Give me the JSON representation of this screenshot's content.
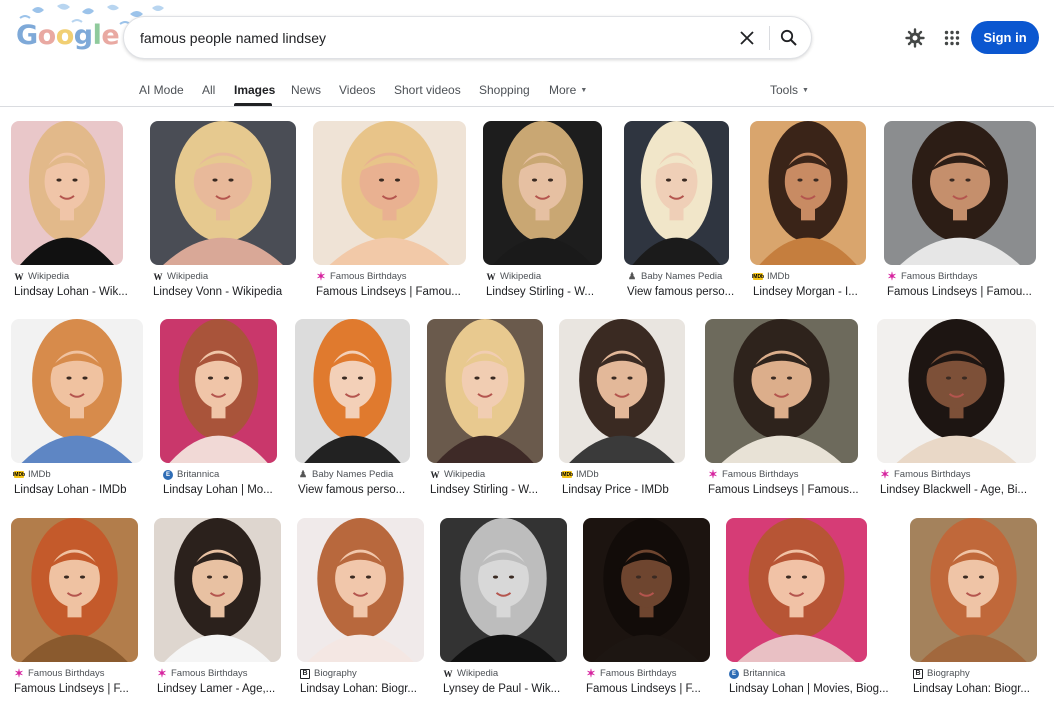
{
  "header": {
    "logo_letters": [
      "G",
      "o",
      "o",
      "g",
      "l",
      "e"
    ],
    "search_value": "famous people named lindsey",
    "clear_icon": "close-icon",
    "search_icon": "search-icon",
    "settings_icon": "gear-icon",
    "apps_icon": "apps-grid-icon",
    "signin_label": "Sign in",
    "accent_color": "#0b57d0"
  },
  "tabs": {
    "ai_mode": "AI Mode",
    "all": "All",
    "images": "Images",
    "news": "News",
    "videos": "Videos",
    "short_videos": "Short videos",
    "shopping": "Shopping",
    "more": "More",
    "tools": "Tools"
  },
  "results": [
    {
      "source": "Wikipedia",
      "title": "Lindsay Lohan - Wik...",
      "source_icon": "wikipedia-icon"
    },
    {
      "source": "Wikipedia",
      "title": "Lindsey Vonn - Wikipedia",
      "source_icon": "wikipedia-icon"
    },
    {
      "source": "Famous Birthdays",
      "title": "Famous Lindseys | Famou...",
      "source_icon": "famous-birthdays-icon"
    },
    {
      "source": "Wikipedia",
      "title": "Lindsey Stirling - W...",
      "source_icon": "wikipedia-icon"
    },
    {
      "source": "Baby Names Pedia",
      "title": "View famous perso...",
      "source_icon": "baby-names-pedia-icon"
    },
    {
      "source": "IMDb",
      "title": "Lindsey Morgan - I...",
      "source_icon": "imdb-icon"
    },
    {
      "source": "Famous Birthdays",
      "title": "Famous Lindseys | Famou...",
      "source_icon": "famous-birthdays-icon"
    },
    {
      "source": "IMDb",
      "title": "Lindsay Lohan - IMDb",
      "source_icon": "imdb-icon"
    },
    {
      "source": "Britannica",
      "title": "Lindsay Lohan | Mo...",
      "source_icon": "britannica-icon"
    },
    {
      "source": "Baby Names Pedia",
      "title": "View famous perso...",
      "source_icon": "baby-names-pedia-icon"
    },
    {
      "source": "Wikipedia",
      "title": "Lindsey Stirling - W...",
      "source_icon": "wikipedia-icon"
    },
    {
      "source": "IMDb",
      "title": "Lindsay Price - IMDb",
      "source_icon": "imdb-icon"
    },
    {
      "source": "Famous Birthdays",
      "title": "Famous Lindseys | Famous...",
      "source_icon": "famous-birthdays-icon"
    },
    {
      "source": "Famous Birthdays",
      "title": "Lindsey Blackwell - Age, Bi...",
      "source_icon": "famous-birthdays-icon"
    },
    {
      "source": "Famous Birthdays",
      "title": "Famous Lindseys | F...",
      "source_icon": "famous-birthdays-icon"
    },
    {
      "source": "Famous Birthdays",
      "title": "Lindsey Lamer - Age,...",
      "source_icon": "famous-birthdays-icon"
    },
    {
      "source": "Biography",
      "title": "Lindsay Lohan: Biogr...",
      "source_icon": "biography-icon"
    },
    {
      "source": "Wikipedia",
      "title": "Lynsey de Paul - Wik...",
      "source_icon": "wikipedia-icon"
    },
    {
      "source": "Famous Birthdays",
      "title": "Famous Lindseys | F...",
      "source_icon": "famous-birthdays-icon"
    },
    {
      "source": "Britannica",
      "title": "Lindsay Lohan | Movies, Biog...",
      "source_icon": "britannica-icon"
    },
    {
      "source": "Biography",
      "title": "Lindsay Lohan: Biogr...",
      "source_icon": "biography-icon"
    }
  ]
}
